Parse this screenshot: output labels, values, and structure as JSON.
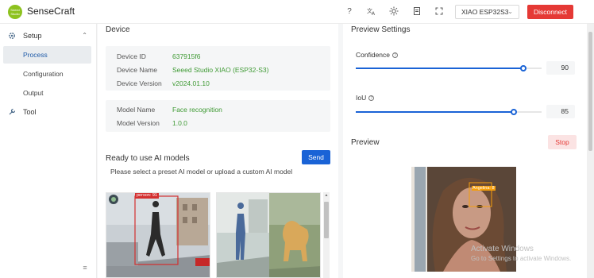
{
  "app": {
    "logo_text": "Seeed Studio",
    "title": "SenseCraft"
  },
  "header": {
    "icons": [
      "help-icon",
      "translate-icon",
      "theme-icon",
      "document-icon",
      "fullscreen-icon"
    ],
    "device_select": "XIAO ESP32S3",
    "disconnect_label": "Disconnect"
  },
  "sidebar": {
    "setup_label": "Setup",
    "items": [
      {
        "label": "Process",
        "active": true
      },
      {
        "label": "Configuration",
        "active": false
      },
      {
        "label": "Output",
        "active": false
      }
    ],
    "tool_label": "Tool"
  },
  "device": {
    "title": "Device",
    "rows": [
      {
        "key": "Device ID",
        "value": "637915f6"
      },
      {
        "key": "Device Name",
        "value": "Seeed Studio XIAO (ESP32-S3)"
      },
      {
        "key": "Device Version",
        "value": "v2024.01.10"
      }
    ],
    "model_rows": [
      {
        "key": "Model Name",
        "value": "Face recognition"
      },
      {
        "key": "Model Version",
        "value": "1.0.0"
      }
    ]
  },
  "models": {
    "title": "Ready to use AI models",
    "send_label": "Send",
    "subtitle": "Please select a preset AI model or upload a custom AI model",
    "card1_label": "person: 91"
  },
  "preview_settings": {
    "title": "Preview Settings",
    "confidence_label": "Confidence",
    "confidence_value": "90",
    "confidence_fraction": 0.9,
    "iou_label": "IoU",
    "iou_value": "85",
    "iou_fraction": 0.85
  },
  "preview": {
    "title": "Preview",
    "stop_label": "Stop",
    "detection_label": "Angelina: 8",
    "watermark_title": "Activate Windows",
    "watermark_sub": "Go to Settings to activate Windows."
  },
  "colors": {
    "accent": "#1a63d6",
    "danger": "#e53935",
    "value_green": "#3f9a34",
    "brand": "#8dc21f"
  }
}
